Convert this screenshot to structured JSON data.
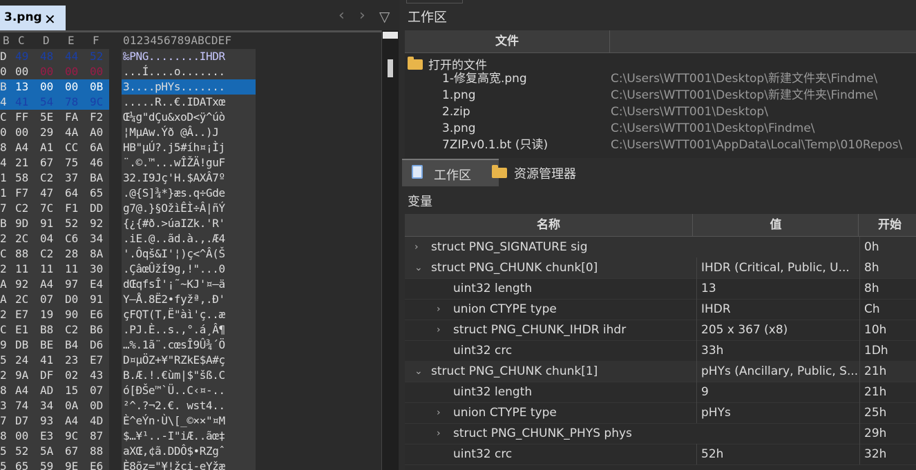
{
  "tab": {
    "filename": "3.png",
    "close": "✕"
  },
  "nav": {
    "back": "‹",
    "forward": "›",
    "dropdown": "▽"
  },
  "hex": {
    "col_headers": [
      "B",
      "C",
      "D",
      "E",
      "F"
    ],
    "ascii_header": "0123456789ABCDEF",
    "rows": [
      {
        "bytes": [
          "D",
          "49",
          "48",
          "44",
          "52"
        ],
        "ascii": "‰PNG........IHDR"
      },
      {
        "bytes": [
          "0",
          "00",
          "00",
          "00",
          "00"
        ],
        "ascii": "...Í....o......."
      },
      {
        "bytes": [
          "B",
          "13",
          "00",
          "00",
          "0B"
        ],
        "ascii": "3....pHYs......."
      },
      {
        "bytes": [
          "4",
          "41",
          "54",
          "78",
          "9C"
        ],
        "ascii": ".....R..€.IDATxœ"
      },
      {
        "bytes": [
          "C",
          "FF",
          "5E",
          "FA",
          "F2"
        ],
        "ascii": "Œ¼g\"dÇu&xoD<ÿ^úò"
      },
      {
        "bytes": [
          "0",
          "00",
          "29",
          "4A",
          "A0"
        ],
        "ascii": "¦MµAw.Ýð @Â..)J "
      },
      {
        "bytes": [
          "8",
          "A4",
          "A1",
          "CC",
          "6A"
        ],
        "ascii": "HB\"µÚ?.j5#íh¤¡Ìj"
      },
      {
        "bytes": [
          "4",
          "21",
          "67",
          "75",
          "46"
        ],
        "ascii": "¨.©.™...wÎŽÄ!guF"
      },
      {
        "bytes": [
          "1",
          "58",
          "C2",
          "37",
          "BA"
        ],
        "ascii": "32.I9Jç'H.$AXÂ7º"
      },
      {
        "bytes": [
          "1",
          "F7",
          "47",
          "64",
          "65"
        ],
        "ascii": ".@{S]¾*}æs.q÷Gde"
      },
      {
        "bytes": [
          "7",
          "C2",
          "7C",
          "F1",
          "DD"
        ],
        "ascii": "g7@.}§OžìÊÌ÷Â|ñÝ"
      },
      {
        "bytes": [
          "B",
          "9D",
          "91",
          "52",
          "92"
        ],
        "ascii": "{¿{#ð.>úaIZk.'R'"
      },
      {
        "bytes": [
          "2",
          "2C",
          "04",
          "C6",
          "34"
        ],
        "ascii": ".iE.@..ãd.à.,.Æ4"
      },
      {
        "bytes": [
          "C",
          "88",
          "C2",
          "28",
          "8A"
        ],
        "ascii": "'.Ôqš&I'¦)ç<^Â(Š"
      },
      {
        "bytes": [
          "2",
          "11",
          "11",
          "11",
          "30"
        ],
        "ascii": ".ÇâœÛžÍ9g,!\"...0"
      },
      {
        "bytes": [
          "A",
          "92",
          "A4",
          "97",
          "E4"
        ],
        "ascii": "dŒqfsÎ'¡˜~KJ'¤—ä"
      },
      {
        "bytes": [
          "A",
          "2C",
          "07",
          "D0",
          "91"
        ],
        "ascii": "Y–Å.8Ë2•fyžª,.Ð'"
      },
      {
        "bytes": [
          "2",
          "E7",
          "19",
          "90",
          "E6"
        ],
        "ascii": "çFQT(T,Ë\"àì'ç..æ"
      },
      {
        "bytes": [
          "C",
          "E1",
          "B8",
          "C2",
          "B6"
        ],
        "ascii": ".PJ.È..s.,°.á¸Â¶"
      },
      {
        "bytes": [
          "9",
          "DB",
          "BE",
          "B4",
          "D6"
        ],
        "ascii": "…%.1ã¨.cœsÎ9Û¾´Ö"
      },
      {
        "bytes": [
          "5",
          "24",
          "41",
          "23",
          "E7"
        ],
        "ascii": "D¤µÖZ+¥\"RZkE$A#ç"
      },
      {
        "bytes": [
          "2",
          "9A",
          "DF",
          "02",
          "43"
        ],
        "ascii": "B.Æ.!.€ùm|$\"šß.C"
      },
      {
        "bytes": [
          "8",
          "A4",
          "AD",
          "15",
          "07"
        ],
        "ascii": "ó[ÐŠe™`Ü..C‹¤-.."
      },
      {
        "bytes": [
          "3",
          "74",
          "34",
          "0A",
          "0D"
        ],
        "ascii": "²^.?¬2.€. wst4.."
      },
      {
        "bytes": [
          "7",
          "D7",
          "93",
          "A4",
          "4D"
        ],
        "ascii": "È^eÝn·Ù\\[_©××\"¤M"
      },
      {
        "bytes": [
          "8",
          "00",
          "E3",
          "9C",
          "87"
        ],
        "ascii": "$…¥¹..-I\"iÆ..ãœ‡"
      },
      {
        "bytes": [
          "5",
          "52",
          "5A",
          "67",
          "88"
        ],
        "ascii": "aXŒ,¢ã.DDÔ$•RZgˆ"
      },
      {
        "bytes": [
          "5",
          "65",
          "59",
          "9E",
          "E6"
        ],
        "ascii": "È8õz=\"¥!žçi-eYžæ"
      }
    ]
  },
  "workspace_top": {
    "title": "工作区"
  },
  "files": {
    "header_file": "文件",
    "group_label": "打开的文件",
    "items": [
      {
        "name": "1-修复高宽.png",
        "path": "C:\\Users\\WTT001\\Desktop\\新建文件夹\\Findme\\"
      },
      {
        "name": "1.png",
        "path": "C:\\Users\\WTT001\\Desktop\\新建文件夹\\Findme\\"
      },
      {
        "name": "2.zip",
        "path": "C:\\Users\\WTT001\\Desktop\\"
      },
      {
        "name": "3.png",
        "path": "C:\\Users\\WTT001\\Desktop\\Findme\\"
      },
      {
        "name": "7ZIP.v0.1.bt (只读)",
        "path": "C:\\Users\\WTT001\\AppData\\Local\\Temp\\010Repos\\"
      }
    ]
  },
  "tabs2": {
    "workspace": "工作区",
    "explorer": "资源管理器"
  },
  "variables": {
    "label": "变量",
    "headers": {
      "name": "名称",
      "value": "值",
      "start": "开始"
    },
    "rows": [
      {
        "indent": 0,
        "arrow": "›",
        "name": "struct PNG_SIGNATURE sig",
        "value": "",
        "start": "0h"
      },
      {
        "indent": 0,
        "arrow": "⌄",
        "name": "struct PNG_CHUNK chunk[0]",
        "value": "IHDR  (Critical, Public, U...",
        "start": "8h"
      },
      {
        "indent": 1,
        "arrow": "",
        "name": "uint32 length",
        "value": "13",
        "start": "8h"
      },
      {
        "indent": 1,
        "arrow": "›",
        "name": "union CTYPE type",
        "value": "IHDR",
        "start": "Ch"
      },
      {
        "indent": 1,
        "arrow": "›",
        "name": "struct PNG_CHUNK_IHDR ihdr",
        "value": "205 x 367 (x8)",
        "start": "10h"
      },
      {
        "indent": 1,
        "arrow": "",
        "name": "uint32 crc",
        "value": "33h",
        "start": "1Dh"
      },
      {
        "indent": 0,
        "arrow": "⌄",
        "name": "struct PNG_CHUNK chunk[1]",
        "value": "pHYs  (Ancillary, Public, S...",
        "start": "21h"
      },
      {
        "indent": 1,
        "arrow": "",
        "name": "uint32 length",
        "value": "9",
        "start": "21h"
      },
      {
        "indent": 1,
        "arrow": "›",
        "name": "union CTYPE type",
        "value": "pHYs",
        "start": "25h"
      },
      {
        "indent": 1,
        "arrow": "›",
        "name": "struct PNG_CHUNK_PHYS phys",
        "value": "",
        "start": "29h"
      },
      {
        "indent": 1,
        "arrow": "",
        "name": "uint32 crc",
        "value": "52h",
        "start": "32h"
      }
    ]
  },
  "colors": {
    "hex_red": "#9b1a48",
    "hex_blue": "#1a3fa8",
    "selection": "#1769b4",
    "tab_bg": "#cfe0f5"
  }
}
